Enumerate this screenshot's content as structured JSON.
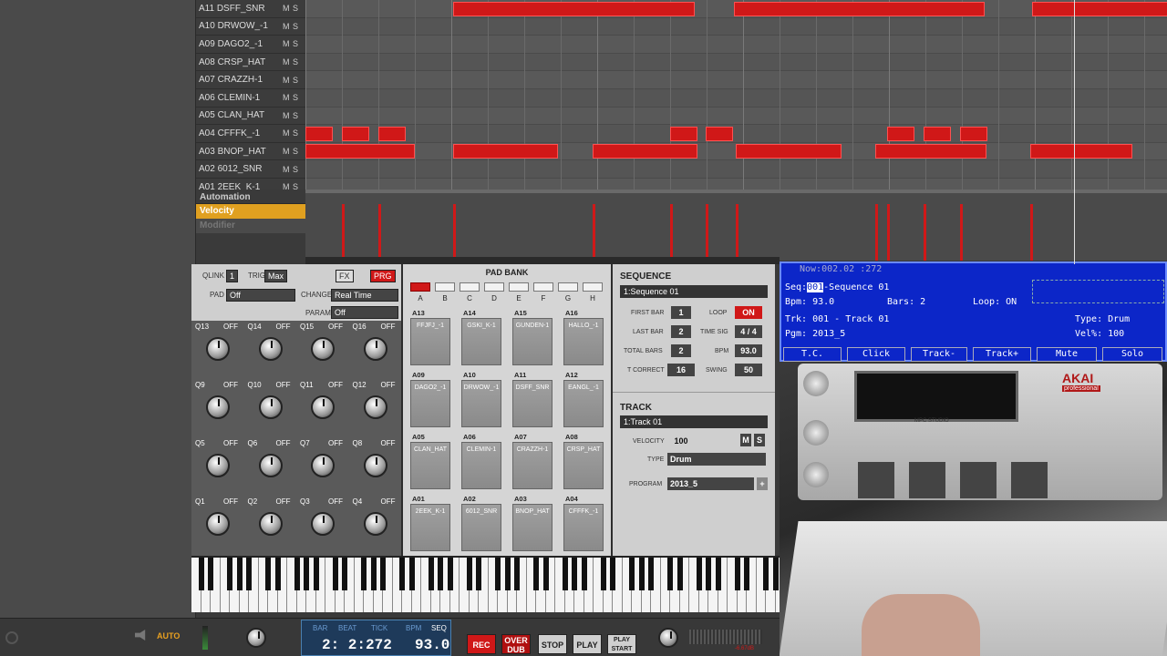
{
  "tracks": [
    {
      "name": "A11 DSFF_SNR",
      "mute": "M",
      "solo": "S"
    },
    {
      "name": "A10 DRWOW_-1",
      "mute": "M",
      "solo": "S"
    },
    {
      "name": "A09 DAGO2_-1",
      "mute": "M",
      "solo": "S"
    },
    {
      "name": "A08 CRSP_HAT",
      "mute": "M",
      "solo": "S"
    },
    {
      "name": "A07 CRAZZH-1",
      "mute": "M",
      "solo": "S"
    },
    {
      "name": "A06 CLEMIN-1",
      "mute": "M",
      "solo": "S"
    },
    {
      "name": "A05 CLAN_HAT",
      "mute": "M",
      "solo": "S"
    },
    {
      "name": "A04 CFFFK_-1",
      "mute": "M",
      "solo": "S"
    },
    {
      "name": "A03 BNOP_HAT",
      "mute": "M",
      "solo": "S"
    },
    {
      "name": "A02 6012_SNR",
      "mute": "M",
      "solo": "S"
    },
    {
      "name": "A01 2EEK_K-1",
      "mute": "M",
      "solo": "S"
    }
  ],
  "automation": {
    "header": "Automation",
    "velocity": "Velocity",
    "modifier": "Modifier"
  },
  "qlink": {
    "label": "QLINK",
    "value": "1",
    "trig_label": "TRIG",
    "trig_value": "Max",
    "fx": "FX",
    "prg": "PRG",
    "pad_label": "PAD",
    "pad_value": "Off",
    "change_label": "CHANGE",
    "change_value": "Real Time",
    "param_label": "PARAM",
    "param_value": "Off",
    "off": "OFF",
    "knobs": [
      "Q13",
      "Q14",
      "Q15",
      "Q16",
      "Q9",
      "Q10",
      "Q11",
      "Q12",
      "Q5",
      "Q6",
      "Q7",
      "Q8",
      "Q1",
      "Q2",
      "Q3",
      "Q4"
    ]
  },
  "padbank": {
    "title": "PAD BANK",
    "banks": [
      "A",
      "B",
      "C",
      "D",
      "E",
      "F",
      "G",
      "H"
    ],
    "pads": [
      {
        "id": "A13",
        "name": "FFJFJ_-1"
      },
      {
        "id": "A14",
        "name": "GSKI_K-1"
      },
      {
        "id": "A15",
        "name": "GUNDEN-1"
      },
      {
        "id": "A16",
        "name": "HALLO_-1"
      },
      {
        "id": "A09",
        "name": "DAGO2_-1"
      },
      {
        "id": "A10",
        "name": "DRWOW_-1"
      },
      {
        "id": "A11",
        "name": "DSFF_SNR"
      },
      {
        "id": "A12",
        "name": "EANGL_-1"
      },
      {
        "id": "A05",
        "name": "CLAN_HAT"
      },
      {
        "id": "A06",
        "name": "CLEMIN-1"
      },
      {
        "id": "A07",
        "name": "CRAZZH-1"
      },
      {
        "id": "A08",
        "name": "CRSP_HAT"
      },
      {
        "id": "A01",
        "name": "2EEK_K-1"
      },
      {
        "id": "A02",
        "name": "6012_SNR"
      },
      {
        "id": "A03",
        "name": "BNOP_HAT"
      },
      {
        "id": "A04",
        "name": "CFFFK_-1"
      }
    ]
  },
  "sequence": {
    "title": "SEQUENCE",
    "selected": "1:Sequence 01",
    "first_bar_label": "FIRST BAR",
    "first_bar": "1",
    "loop_label": "LOOP",
    "loop": "ON",
    "last_bar_label": "LAST BAR",
    "last_bar": "2",
    "time_sig_label": "TIME SIG",
    "time_sig": "4 / 4",
    "total_bars_label": "TOTAL BARS",
    "total_bars": "2",
    "bpm_label": "BPM",
    "bpm": "93.0",
    "tcorrect_label": "T CORRECT",
    "tcorrect": "16",
    "swing_label": "SWING",
    "swing": "50"
  },
  "track": {
    "title": "TRACK",
    "selected": "1:Track 01",
    "velocity_label": "VELOCITY",
    "velocity": "100",
    "m": "M",
    "s": "S",
    "type_label": "TYPE",
    "type": "Drum",
    "program_label": "PROGRAM",
    "program": "2013_5",
    "plus": "+"
  },
  "transport": {
    "auto": "AUTO",
    "bar_label": "BAR",
    "beat_label": "BEAT",
    "tick_label": "TICK",
    "bpm_label": "BPM",
    "seq_label": "SEQ",
    "position": "2: 2:272",
    "bpm": "93.0",
    "rec": "REC",
    "overdub": "OVER DUB",
    "stop": "STOP",
    "play": "PLAY",
    "play_start": "PLAY START",
    "level": "-6.67dB"
  },
  "mpc_screen": {
    "now": "Now:002.02 :272",
    "seq_label": "Seq:",
    "seq_num": "001",
    "seq_name": "-Sequence 01",
    "bpm": "Bpm: 93.0",
    "bars": "Bars: 2",
    "loop": "Loop: ON",
    "trk": "Trk: 001 - Track 01",
    "type": "Type: Drum",
    "pgm": "Pgm: 2013_5",
    "vel": "Vel%: 100",
    "softkeys": [
      "T.C.",
      "Click",
      "Track-",
      "Track+",
      "Mute",
      "Solo"
    ]
  },
  "device": {
    "brand": "AKAI",
    "sub": "professional",
    "model": "MPC STUDIO"
  }
}
